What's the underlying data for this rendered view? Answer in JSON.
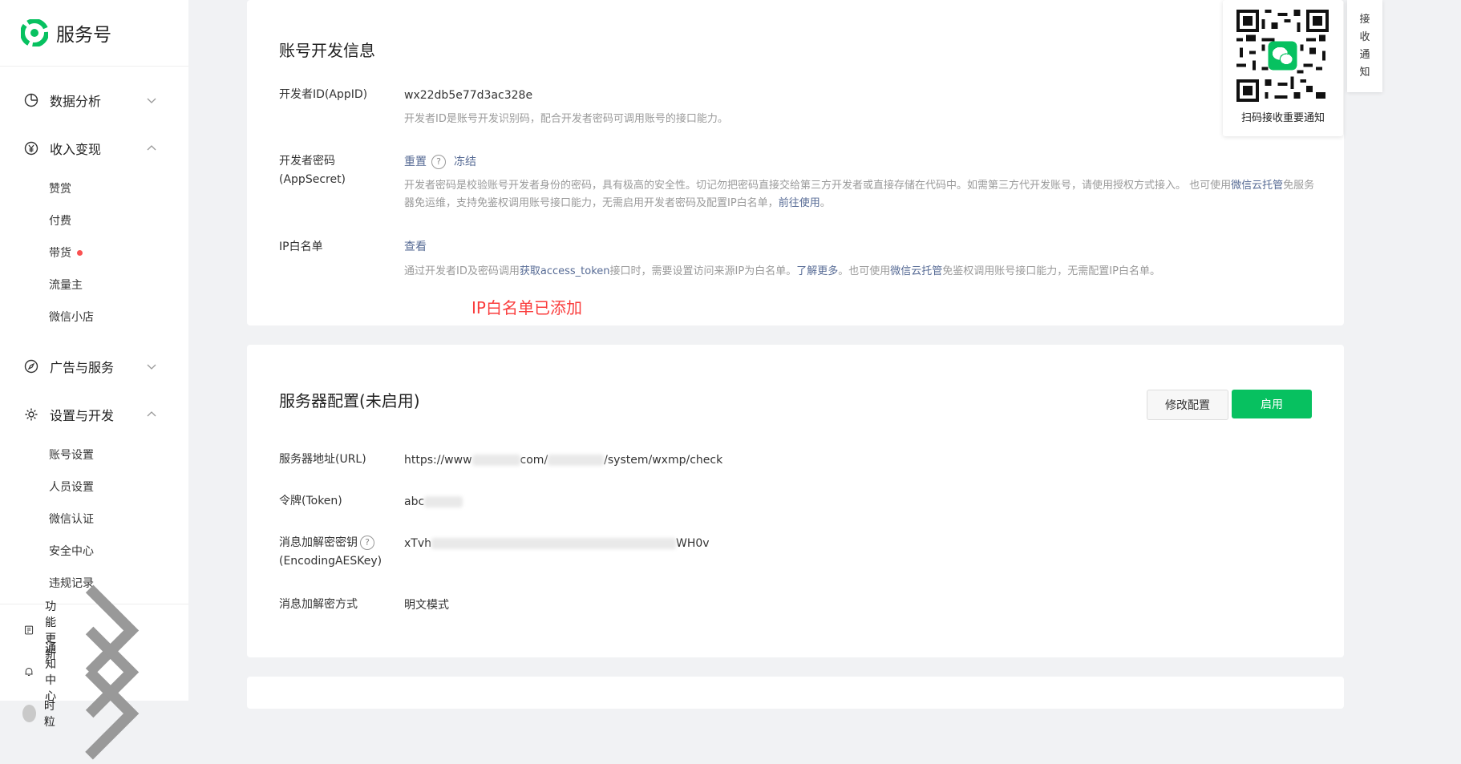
{
  "brand": {
    "title": "服务号"
  },
  "sidebar": {
    "groups": [
      {
        "label": "数据分析",
        "icon": "chart-icon",
        "expanded": false
      },
      {
        "label": "收入变现",
        "icon": "yen-icon",
        "expanded": true,
        "items": [
          {
            "label": "赞赏"
          },
          {
            "label": "付费"
          },
          {
            "label": "带货",
            "dot": true
          },
          {
            "label": "流量主"
          },
          {
            "label": "微信小店"
          }
        ]
      },
      {
        "label": "广告与服务",
        "icon": "compass-icon",
        "expanded": false
      },
      {
        "label": "设置与开发",
        "icon": "gear-icon",
        "expanded": true,
        "items": [
          {
            "label": "账号设置"
          },
          {
            "label": "人员设置"
          },
          {
            "label": "微信认证"
          },
          {
            "label": "安全中心"
          },
          {
            "label": "违规记录"
          }
        ]
      }
    ],
    "bottom": [
      {
        "label": "功能更新",
        "icon": "update-icon"
      },
      {
        "label": "通知中心",
        "icon": "bell-icon"
      },
      {
        "label": "时粒",
        "icon": "avatar"
      }
    ]
  },
  "dev_info": {
    "title": "账号开发信息",
    "appid_label": "开发者ID(AppID)",
    "appid_value": "wx22db5e77d3ac328e",
    "appid_desc": "开发者ID是账号开发识别码，配合开发者密码可调用账号的接口能力。",
    "secret_label": "开发者密码(AppSecret)",
    "secret_reset": "重置",
    "secret_freeze": "冻结",
    "secret_desc_1": "开发者密码是校验账号开发者身份的密码，具有极高的安全性。切记勿把密码直接交给第三方开发者或直接存储在代码中。如需第三方代开发账号，请使用授权方式接入。 也可使用",
    "secret_desc_link1": "微信云托管",
    "secret_desc_2": "免服务器免运维，支持免鉴权调用账号接口能力，无需启用开发者密码及配置IP白名单，",
    "secret_desc_link2": "前往使用",
    "secret_desc_3": "。",
    "ip_label": "IP白名单",
    "ip_view": "查看",
    "ip_desc_1": "通过开发者ID及密码调用",
    "ip_desc_link1": "获取access_token",
    "ip_desc_2": "接口时，需要设置访问来源IP为白名单。",
    "ip_desc_link2": "了解更多",
    "ip_desc_3": "。也可使用",
    "ip_desc_link3": "微信云托管",
    "ip_desc_4": "免鉴权调用账号接口能力，无需配置IP白名单。",
    "annotation": "IP白名单已添加"
  },
  "server_config": {
    "title": "服务器配置(未启用)",
    "modify_button": "修改配置",
    "enable_button": "启用",
    "url_label": "服务器地址(URL)",
    "url_prefix": "https://www",
    "url_mid": "com/",
    "url_suffix": "/system/wxmp/check",
    "token_label": "令牌(Token)",
    "token_prefix": "abc",
    "aes_label_1": "消息加解密密钥",
    "aes_label_2": "(EncodingAESKey)",
    "aes_prefix": "xTvh",
    "aes_suffix": "WH0v",
    "mode_label": "消息加解密方式",
    "mode_value": "明文模式"
  },
  "qr_popup": {
    "caption": "扫码接收重要通知"
  },
  "notice_tab": {
    "label": [
      "接",
      "收",
      "通",
      "知"
    ]
  },
  "colors": {
    "accent": "#07c160",
    "link": "#576b95",
    "annotation": "#fa3d3d"
  }
}
